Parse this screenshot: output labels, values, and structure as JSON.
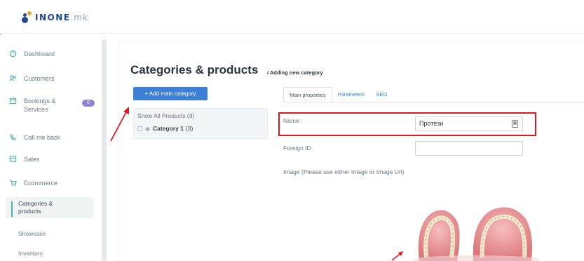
{
  "app": {
    "logo_text": "INONE",
    "logo_tld": ".mk"
  },
  "sidebar": {
    "items": [
      {
        "label": "Dashboard",
        "icon": "dashboard-icon"
      },
      {
        "label": "Customers",
        "icon": "users-icon"
      },
      {
        "label": "Bookings & Services",
        "icon": "calendar-icon",
        "badge": "0"
      },
      {
        "label": "Call me back",
        "icon": "phone-icon"
      },
      {
        "label": "Sales",
        "icon": "sales-icon"
      },
      {
        "label": "Ecommerce",
        "icon": "cart-icon"
      }
    ],
    "sub_items": [
      {
        "label": "Categories & products",
        "active": true
      },
      {
        "label": "Showcase",
        "active": false
      },
      {
        "label": "Inventory",
        "active": false
      }
    ]
  },
  "page": {
    "title": "Categories & products",
    "subtitle": "/ Adding new category",
    "add_button": "+ Add main category"
  },
  "tree": {
    "show_all": "Show All Products (3)",
    "category_name": "Category 1",
    "category_count": "(3)"
  },
  "tabs": [
    {
      "label": "Main properties",
      "active": true
    },
    {
      "label": "Parameters",
      "active": false
    },
    {
      "label": "SEO",
      "active": false
    }
  ],
  "form": {
    "name_label": "Name",
    "name_value": "Протези",
    "foreign_id_label": "Foreign ID",
    "foreign_id_value": "",
    "image_label": "Image (Please use either Image or Image Url)"
  },
  "colors": {
    "accent": "#3b7fd6",
    "highlight": "#e0191f",
    "sidebar_icon": "#4bb3ad",
    "badge": "#8c84d6"
  }
}
